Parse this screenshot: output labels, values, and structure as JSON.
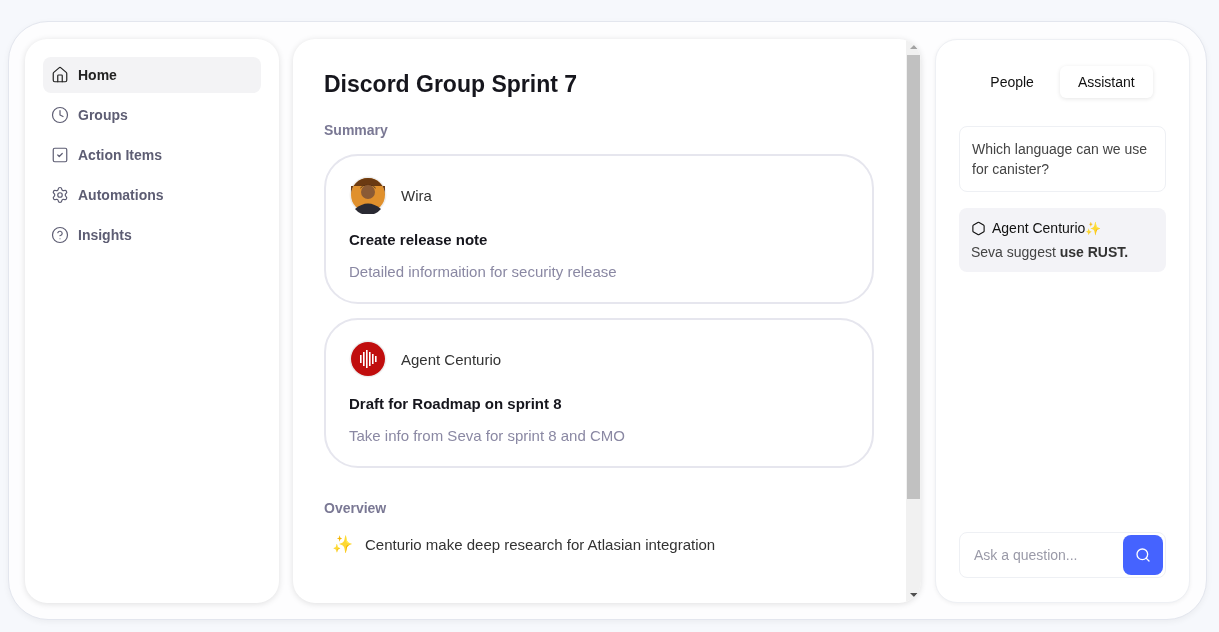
{
  "sidebar": {
    "items": [
      {
        "label": "Home",
        "selected": true
      },
      {
        "label": "Groups",
        "selected": false
      },
      {
        "label": "Action Items",
        "selected": false
      },
      {
        "label": "Automations",
        "selected": false
      },
      {
        "label": "Insights",
        "selected": false
      }
    ]
  },
  "main": {
    "title": "Discord Group Sprint 7",
    "summary_heading": "Summary",
    "cards": [
      {
        "author": "Wira",
        "kind": "person",
        "title": "Create release note",
        "detail": "Detailed informaition for security release"
      },
      {
        "author": "Agent Centurio",
        "kind": "agent",
        "title": "Draft for Roadmap on sprint 8",
        "detail": "Take info from Seva for sprint 8 and CMO"
      }
    ],
    "overview_heading": "Overview",
    "overview": [
      {
        "icon": "✨",
        "text": "Centurio make deep research for Atlasian integration"
      }
    ]
  },
  "assistant": {
    "tabs": [
      {
        "label": "People",
        "selected": false
      },
      {
        "label": "Assistant",
        "selected": true
      }
    ],
    "question": "Which language can we use for canister?",
    "reply": {
      "author": "Agent Centurio",
      "badge": "✨",
      "text": "Seva suggest **use RUST.**"
    },
    "input": {
      "placeholder": "Ask a question..."
    }
  }
}
